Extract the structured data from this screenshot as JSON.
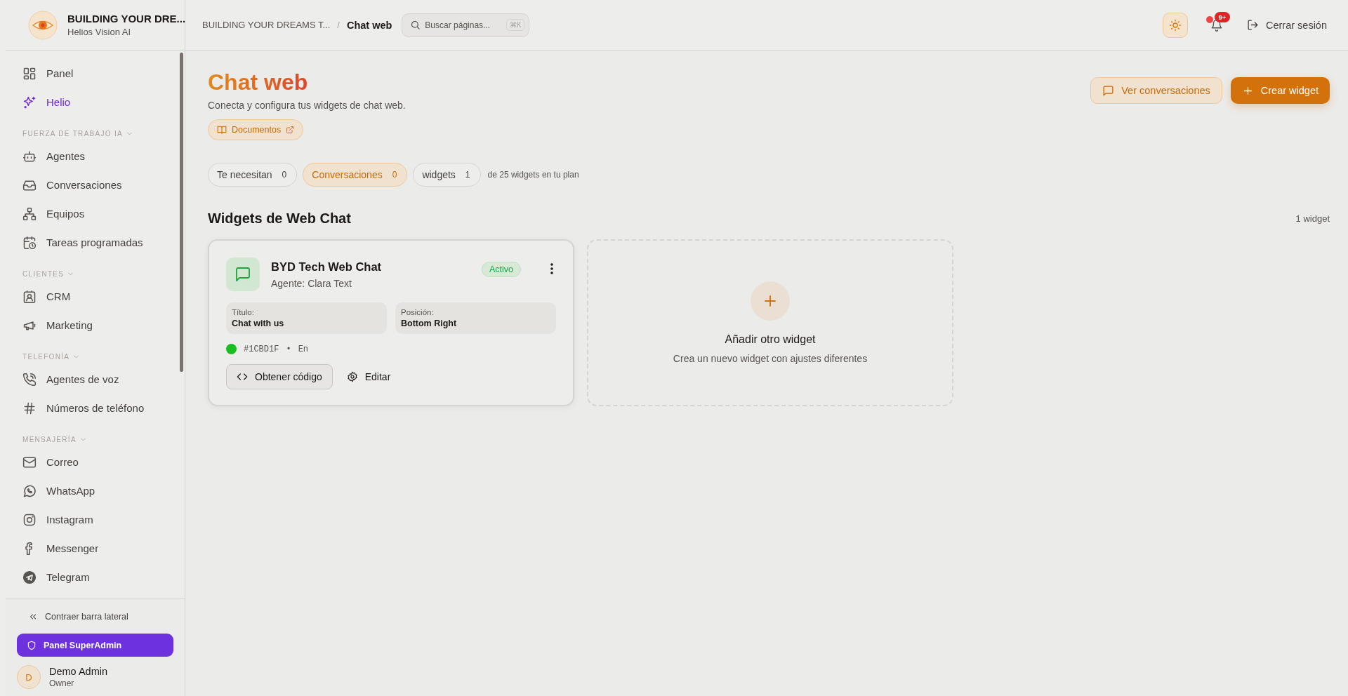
{
  "org": {
    "name": "BUILDING YOUR DRE...",
    "subtitle": "Helios Vision AI"
  },
  "breadcrumb_separator": "/",
  "breadcrumb": [
    {
      "label": "BUILDING YOUR DREAMS T...",
      "current": false
    },
    {
      "label": "Chat web",
      "current": true
    }
  ],
  "search": {
    "placeholder": "Buscar páginas...",
    "shortcut": "⌘K"
  },
  "notifications": {
    "badge": "9+"
  },
  "logout": "Cerrar sesión",
  "sidebar": {
    "sections": [
      {
        "items": [
          {
            "label": "Panel",
            "selected": false
          },
          {
            "label": "Helio",
            "selected": true
          }
        ]
      },
      {
        "title": "FUERZA DE TRABAJO IA",
        "items": [
          {
            "label": "Agentes",
            "selected": false
          },
          {
            "label": "Conversaciones",
            "selected": false
          },
          {
            "label": "Equipos",
            "selected": false
          },
          {
            "label": "Tareas programadas",
            "selected": false
          }
        ]
      },
      {
        "title": "CLIENTES",
        "items": [
          {
            "label": "CRM",
            "selected": false
          },
          {
            "label": "Marketing",
            "selected": false
          }
        ]
      },
      {
        "title": "TELEFONÍA",
        "items": [
          {
            "label": "Agentes de voz",
            "selected": false
          },
          {
            "label": "Números de teléfono",
            "selected": false
          }
        ]
      },
      {
        "title": "MENSAJERÍA",
        "items": [
          {
            "label": "Correo",
            "selected": false
          },
          {
            "label": "WhatsApp",
            "selected": false
          },
          {
            "label": "Instagram",
            "selected": false
          },
          {
            "label": "Messenger",
            "selected": false
          },
          {
            "label": "Telegram",
            "selected": false
          }
        ]
      }
    ],
    "collapse": "Contraer barra lateral",
    "admin_button": "Panel SuperAdmin",
    "user": {
      "initial": "D",
      "name": "Demo Admin",
      "role": "Owner"
    }
  },
  "page": {
    "title": "Chat web",
    "subtitle": "Conecta y configura tus widgets de chat web.",
    "docs": "Documentos",
    "actions": [
      "Ver conversaciones",
      "Crear widget"
    ]
  },
  "filters": [
    {
      "label": "Te necesitan",
      "count": "0",
      "selected": false
    },
    {
      "label": "Conversaciones",
      "count": "0",
      "selected": true
    },
    {
      "label": "widgets",
      "count": "1",
      "selected": false
    }
  ],
  "plan_note": "de 25 widgets en tu plan",
  "section": {
    "title": "Widgets de Web Chat",
    "count": "1 widget"
  },
  "widgets": [
    {
      "name": "BYD Tech Web Chat",
      "agent": "Agente: Clara Text",
      "status": "Activo",
      "active": true,
      "fields": [
        {
          "label": "Título:",
          "value": "Chat with us"
        },
        {
          "label": "Posición:",
          "value": "Bottom Right"
        }
      ],
      "color": "#1cbd1f",
      "color_label": "#1CBD1F",
      "meta_separator": "•",
      "language": "En",
      "actions": [
        "Obtener código",
        "Editar"
      ]
    }
  ],
  "add_card": {
    "title": "Añadir otro widget",
    "subtitle": "Crea un nuevo widget con ajustes diferentes"
  }
}
